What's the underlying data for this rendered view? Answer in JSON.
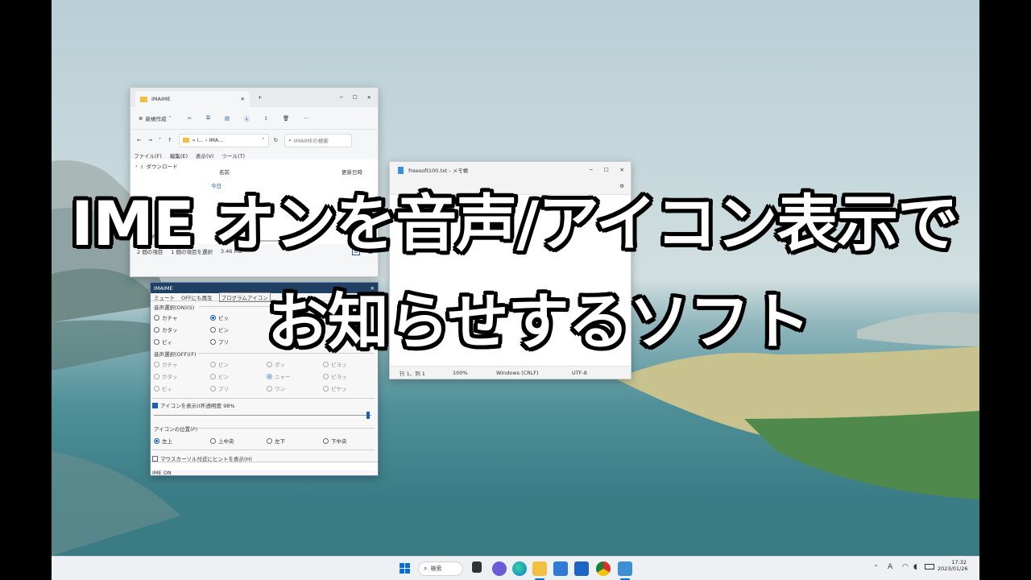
{
  "headline": {
    "line1": "IME オンを音声/アイコン表示で",
    "line2": "お知らせするソフト"
  },
  "explorer": {
    "title": "IMAIME",
    "new_button": "新規作成",
    "address": "« i... › IMA...",
    "search_placeholder": "IMAIMEの検索",
    "menu": [
      "ファイル(F)",
      "編集(E)",
      "表示(V)",
      "ツール(T)"
    ],
    "nav_item": "ダウンロード",
    "col_name": "名前",
    "col_date": "更新日時",
    "group_today": "今日",
    "file_partial": "P2P-QuakeIm...",
    "status_items": "2 個の項目",
    "status_selected": "1 個の項目を選択",
    "status_size": "3.46 MB"
  },
  "notepad": {
    "title": "freesoft100.txt - メモ帳",
    "status": [
      "行 1、列 1",
      "100%",
      "Windows (CRLF)",
      "UTF-8"
    ]
  },
  "imaime": {
    "title": "IMAIME",
    "tabs": [
      "ミュート",
      "OFFにも再生",
      "プログラムアイコン"
    ],
    "group_on": "音声選択(ON)(S)",
    "on_options": [
      "カチャ",
      "ピッ",
      "カタッ",
      "ピン",
      "ピィ",
      "プリ"
    ],
    "group_off": "音声選択(OFF)(F)",
    "off_options": [
      "カチャ",
      "ピン",
      "ポッ",
      "ピヨッ",
      "カタッ",
      "ピン",
      "ニャー",
      "ピヨッ",
      "ピィ",
      "プリ",
      "ワン",
      "ピヤッ"
    ],
    "show_icon": "アイコンを表示(I)",
    "opacity": "不透明度 98%",
    "group_pos": "アイコンの位置(P)",
    "positions": [
      "左上",
      "上中央",
      "左下",
      "下中央"
    ],
    "mouse_hint": "マウスカーソル付近にヒントを表示(H)",
    "status": "IME ON"
  },
  "taskbar": {
    "search": "検索",
    "time": "17:32",
    "date": "2023/01/26",
    "ime_indicator": "A"
  },
  "colors": {
    "accent": "#1a5fb4",
    "imaime_title_bar": "#1f3f63",
    "taskbar": "#eef1f3"
  }
}
